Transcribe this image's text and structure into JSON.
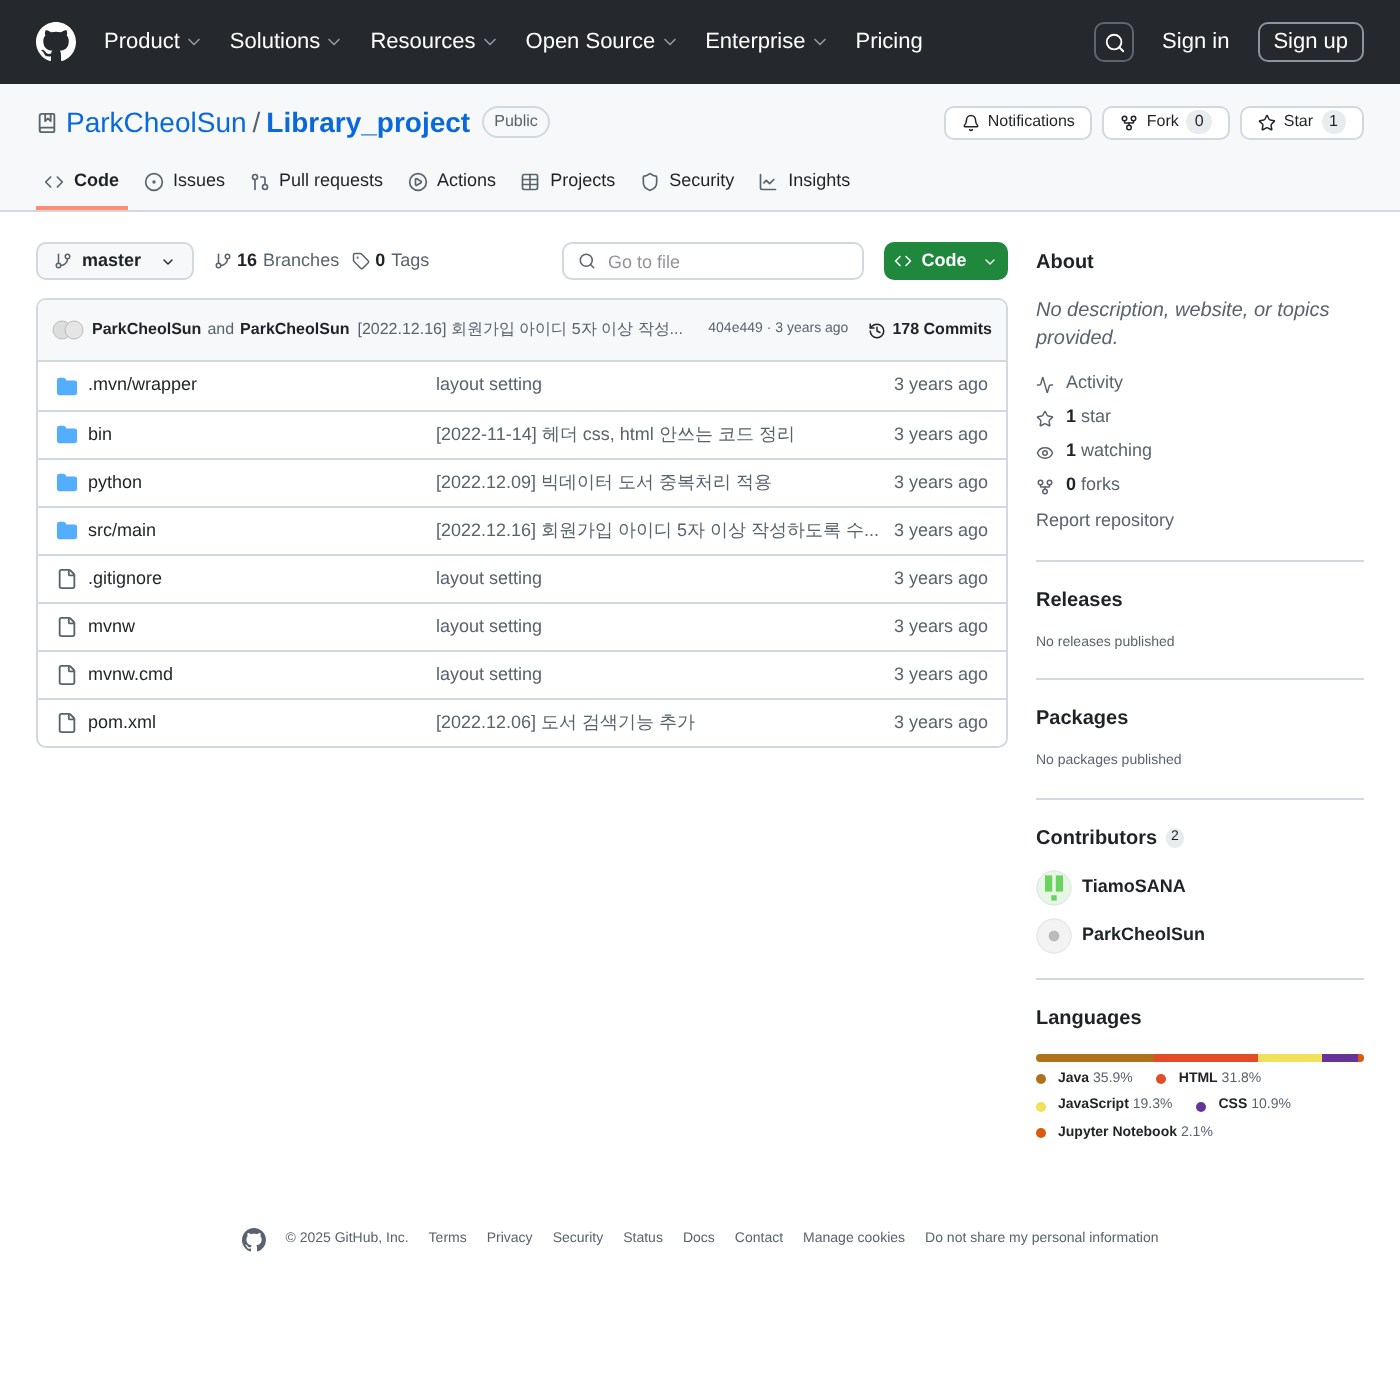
{
  "header": {
    "nav": [
      "Product",
      "Solutions",
      "Resources",
      "Open Source",
      "Enterprise",
      "Pricing"
    ],
    "sign_in": "Sign in",
    "sign_up": "Sign up"
  },
  "repo": {
    "owner": "ParkCheolSun",
    "separator": "/",
    "name": "Library_project",
    "visibility": "Public",
    "notifications": "Notifications",
    "fork": "Fork",
    "fork_count": "0",
    "star": "Star",
    "star_count": "1"
  },
  "tabs": [
    {
      "label": "Code",
      "kind": "code",
      "selected": true
    },
    {
      "label": "Issues",
      "kind": "issues",
      "selected": false
    },
    {
      "label": "Pull requests",
      "kind": "pulls",
      "selected": false
    },
    {
      "label": "Actions",
      "kind": "actions",
      "selected": false
    },
    {
      "label": "Projects",
      "kind": "projects",
      "selected": false
    },
    {
      "label": "Security",
      "kind": "security",
      "selected": false
    },
    {
      "label": "Insights",
      "kind": "insights",
      "selected": false
    }
  ],
  "toolbar": {
    "branch": "master",
    "branches_count": "16",
    "branches_label": "Branches",
    "tags_count": "0",
    "tags_label": "Tags",
    "search_placeholder": "Go to file",
    "code_button": "Code"
  },
  "commit": {
    "author_1": "ParkCheolSun",
    "joiner": "and",
    "author_2": "ParkCheolSun",
    "message": "[2022.12.16] 회원가입 아이디 5자 이상 작성...",
    "meta": "404e449 · 3 years ago",
    "commits": "178 Commits"
  },
  "files": [
    {
      "name": ".mvn/wrapper",
      "kind": "folder",
      "message": "layout setting",
      "age": "3 years ago"
    },
    {
      "name": "bin",
      "kind": "folder",
      "message": "[2022-11-14] 헤더 css, html 안쓰는 코드 정리",
      "age": "3 years ago"
    },
    {
      "name": "python",
      "kind": "folder",
      "message": "[2022.12.09] 빅데이터 도서 중복처리 적용",
      "age": "3 years ago"
    },
    {
      "name": "src/main",
      "kind": "folder",
      "message": "[2022.12.16] 회원가입 아이디 5자 이상 작성하도록 수...",
      "age": "3 years ago"
    },
    {
      "name": ".gitignore",
      "kind": "file",
      "message": "layout setting",
      "age": "3 years ago"
    },
    {
      "name": "mvnw",
      "kind": "file",
      "message": "layout setting",
      "age": "3 years ago"
    },
    {
      "name": "mvnw.cmd",
      "kind": "file",
      "message": "layout setting",
      "age": "3 years ago"
    },
    {
      "name": "pom.xml",
      "kind": "file",
      "message": "[2022.12.06] 도서 검색기능 추가",
      "age": "3 years ago"
    }
  ],
  "about": {
    "title": "About",
    "description": "No description, website, or topics provided.",
    "items": [
      {
        "kind": "activity",
        "label": "Activity"
      },
      {
        "kind": "star",
        "count": "1",
        "label": "star"
      },
      {
        "kind": "watch",
        "count": "1",
        "label": "watching"
      },
      {
        "kind": "fork",
        "count": "0",
        "label": "forks"
      }
    ],
    "report": "Report repository"
  },
  "releases": {
    "title": "Releases",
    "text": "No releases published"
  },
  "packages": {
    "title": "Packages",
    "text": "No packages published"
  },
  "contributors": {
    "title": "Contributors",
    "count": "2",
    "people": [
      {
        "name": "TiamoSANA"
      },
      {
        "name": "ParkCheolSun"
      }
    ]
  },
  "languages": {
    "title": "Languages",
    "items": [
      {
        "name": "Java",
        "percent": "35.9%",
        "color": "#b07219"
      },
      {
        "name": "HTML",
        "percent": "31.8%",
        "color": "#e34c26"
      },
      {
        "name": "JavaScript",
        "percent": "19.3%",
        "color": "#f1e05a"
      },
      {
        "name": "CSS",
        "percent": "10.9%",
        "color": "#663399"
      },
      {
        "name": "Jupyter Notebook",
        "percent": "2.1%",
        "color": "#da5b0b"
      }
    ]
  },
  "footer": {
    "copyright": "© 2025 GitHub, Inc.",
    "links": [
      "Terms",
      "Privacy",
      "Security",
      "Status",
      "Docs",
      "Contact",
      "Manage cookies",
      "Do not share my personal information"
    ]
  }
}
